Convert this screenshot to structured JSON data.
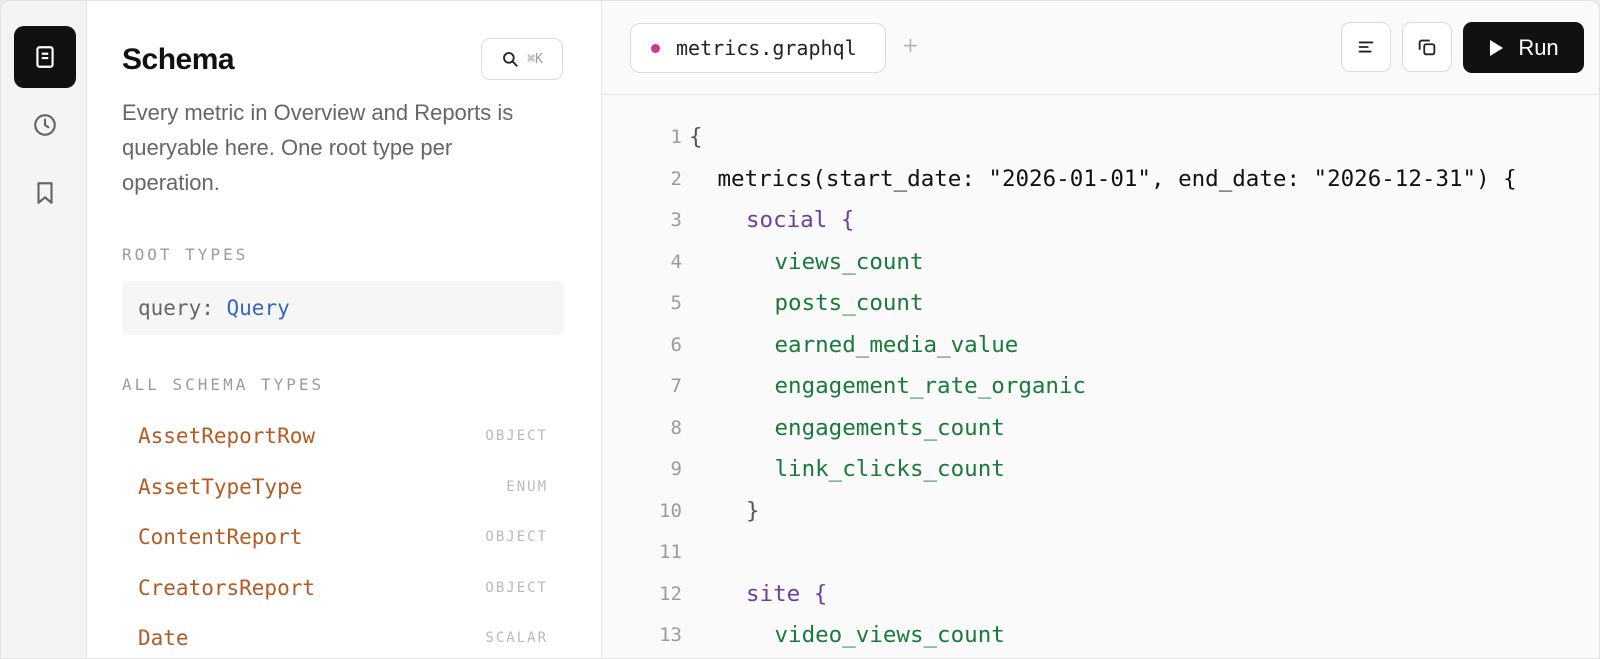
{
  "rail": {
    "items": [
      {
        "icon": "schema-book-icon",
        "active": true
      },
      {
        "icon": "history-clock-icon",
        "active": false
      },
      {
        "icon": "bookmark-icon",
        "active": false
      }
    ]
  },
  "schema": {
    "title": "Schema",
    "search_shortcut": "⌘K",
    "description": "Every metric in Overview and Reports is queryable here. One root type per operation.",
    "root_types_label": "ROOT TYPES",
    "root_type": {
      "key": "query:",
      "value": "Query"
    },
    "all_types_label": "ALL SCHEMA TYPES",
    "types": [
      {
        "name": "AssetReportRow",
        "kind": "OBJECT"
      },
      {
        "name": "AssetTypeType",
        "kind": "ENUM"
      },
      {
        "name": "ContentReport",
        "kind": "OBJECT"
      },
      {
        "name": "CreatorsReport",
        "kind": "OBJECT"
      },
      {
        "name": "Date",
        "kind": "SCALAR"
      }
    ]
  },
  "editor": {
    "tab": {
      "name": "metrics.graphql"
    },
    "add_tab": "+",
    "run_label": "Run",
    "lines": [
      {
        "num": "1",
        "indent": 0,
        "text": "{",
        "kind": "brace"
      },
      {
        "num": "2",
        "indent": 1,
        "text": "metrics(start_date: \"2026-01-01\", end_date: \"2026-12-31\") {",
        "kind": "plain"
      },
      {
        "num": "3",
        "indent": 2,
        "text": "social {",
        "kind": "key"
      },
      {
        "num": "4",
        "indent": 3,
        "text": "views_count",
        "kind": "field"
      },
      {
        "num": "5",
        "indent": 3,
        "text": "posts_count",
        "kind": "field"
      },
      {
        "num": "6",
        "indent": 3,
        "text": "earned_media_value",
        "kind": "field"
      },
      {
        "num": "7",
        "indent": 3,
        "text": "engagement_rate_organic",
        "kind": "field"
      },
      {
        "num": "8",
        "indent": 3,
        "text": "engagements_count",
        "kind": "field"
      },
      {
        "num": "9",
        "indent": 3,
        "text": "link_clicks_count",
        "kind": "field"
      },
      {
        "num": "10",
        "indent": 2,
        "text": "}",
        "kind": "brace"
      },
      {
        "num": "11",
        "indent": 0,
        "text": "",
        "kind": "plain"
      },
      {
        "num": "12",
        "indent": 2,
        "text": "site {",
        "kind": "key"
      },
      {
        "num": "13",
        "indent": 3,
        "text": "video_views_count",
        "kind": "field"
      }
    ]
  },
  "colors": {
    "accent_dot": "#d6338a",
    "type_name": "#b45a23",
    "root_value": "#3565c0",
    "code_key": "#6b3fa0",
    "code_field": "#1a7a3c"
  }
}
